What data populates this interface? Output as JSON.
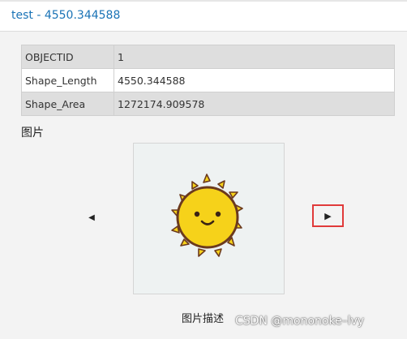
{
  "window": {
    "title": "test - 4550.344588"
  },
  "attributes": {
    "rows": [
      {
        "field": "OBJECTID",
        "value": "1"
      },
      {
        "field": "Shape_Length",
        "value": "4550.344588"
      },
      {
        "field": "Shape_Area",
        "value": "1272174.909578"
      }
    ]
  },
  "image_section": {
    "title": "图片",
    "image_name": "sun-smiley-icon",
    "caption": "图片描述",
    "prev_icon": "triangle-left-icon",
    "next_icon": "triangle-right-icon",
    "prev_glyph": "◀",
    "next_glyph": "▶"
  },
  "watermark": "CSDN @mononoke–lvy",
  "colors": {
    "title": "#1a73b6",
    "highlight": "#e03a3a",
    "sun_fill": "#f6d21a",
    "sun_outline": "#6b3a1e"
  }
}
